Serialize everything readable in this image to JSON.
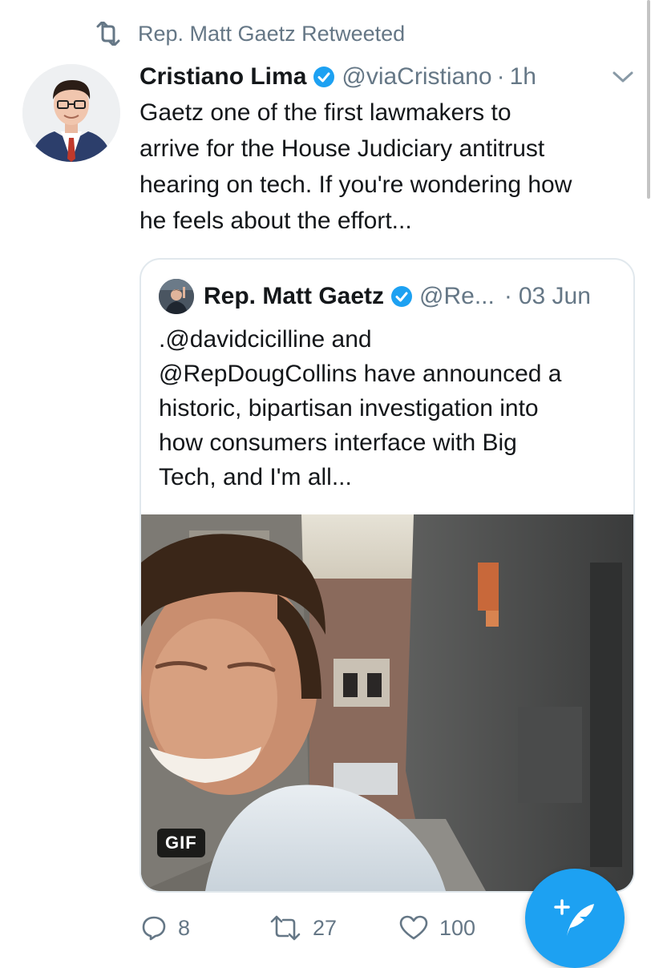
{
  "retweet_banner": {
    "text": "Rep. Matt Gaetz Retweeted",
    "icon": "retweet-icon"
  },
  "tweet": {
    "author_name": "Cristiano Lima",
    "handle": "@viaCristiano",
    "separator": "·",
    "time": "1h",
    "verified": true,
    "text_lines": [
      "Gaetz one of the first lawmakers to",
      "arrive for the House Judiciary antitrust",
      "hearing on tech. If you're wondering how",
      "he feels about the effort..."
    ]
  },
  "quoted_tweet": {
    "author_name": "Rep. Matt Gaetz",
    "handle": "@Re...",
    "separator": "·",
    "date": "03 Jun",
    "verified": true,
    "text_lines": [
      ".@davidcicilline and",
      "@RepDougCollins have announced a",
      "historic, bipartisan investigation into",
      "how consumers interface with Big",
      "Tech, and I'm all..."
    ],
    "media_badge": "GIF"
  },
  "actions": {
    "replies": "8",
    "retweets": "27",
    "likes": "100"
  },
  "colors": {
    "accent": "#1da1f2",
    "muted": "#657786",
    "text": "#14171a",
    "border": "#e1e8ed"
  },
  "icons": [
    "retweet-icon",
    "verified-badge-icon",
    "chevron-down-icon",
    "reply-icon",
    "like-icon",
    "compose-tweet-icon"
  ]
}
